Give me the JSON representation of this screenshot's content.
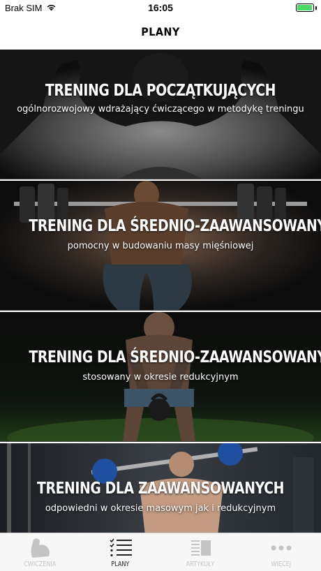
{
  "status_bar": {
    "carrier": "Brak SIM",
    "time": "16:05",
    "battery_level": 0.95,
    "battery_color": "#4cd964"
  },
  "nav": {
    "title": "PLANY"
  },
  "plans": [
    {
      "title": "TRENING DLA POCZĄTKUJĄCYCH",
      "description": "ogólnorozwojowy wdrażający ćwiczącego w metodykę treningu"
    },
    {
      "title": "TRENING DLA ŚREDNIO-ZAAWANSOWANYCH",
      "description": "pomocny w budowaniu masy mięśniowej"
    },
    {
      "title": "TRENING DLA ŚREDNIO-ZAAWANSOWANYCH",
      "description": "stosowany w okresie redukcyjnym"
    },
    {
      "title": "TRENING DLA ZAAWANSOWANYCH",
      "description": "odpowiedni w okresie masowym jak i redukcyjnym"
    }
  ],
  "tabs": [
    {
      "label": "ĆWICZENIA",
      "icon": "flexed-arm-icon",
      "active": false
    },
    {
      "label": "PLANY",
      "icon": "checklist-icon",
      "active": true
    },
    {
      "label": "ARTYKUŁY",
      "icon": "articles-icon",
      "active": false
    },
    {
      "label": "WIĘCEJ",
      "icon": "more-dots-icon",
      "active": false
    }
  ],
  "colors": {
    "tab_inactive": "#c4c4c4",
    "tab_active": "#222222"
  }
}
